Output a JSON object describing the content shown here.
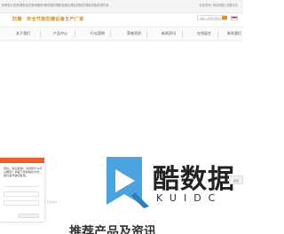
{
  "top_strip": {
    "left_text": "防爆型仪表|防爆电机|防爆电器|防爆照明|防爆配电箱|防爆控制箱|防爆接线箱|防爆风机",
    "right_text": "在线咨询 | 网站地图 | 收藏本站"
  },
  "header": {
    "logo_text": "防爆 · 安全节能防爆设备生产厂家",
    "search_placeholder": "请输入搜索关键词"
  },
  "nav": {
    "items": [
      "关于我们",
      "产品中心",
      "行业案例",
      "荣誉资质",
      "新闻资讯",
      "在线留言",
      "联系我们"
    ]
  },
  "chat": {
    "message": "您好，欢迎咨询！请问有什么可以帮您？请留下您的联系方式，我们会尽快回复您。"
  },
  "faint_label": "仅供参考",
  "watermark": {
    "main": "酷数据",
    "sub": "KUIDC"
  },
  "side_tab_label": "客服",
  "bottom_heading": "推荐产品及资讯",
  "colors": {
    "accent_orange": "#e8612c",
    "logo_gold": "#d8942b",
    "watermark_blue": "#4aa3df"
  }
}
